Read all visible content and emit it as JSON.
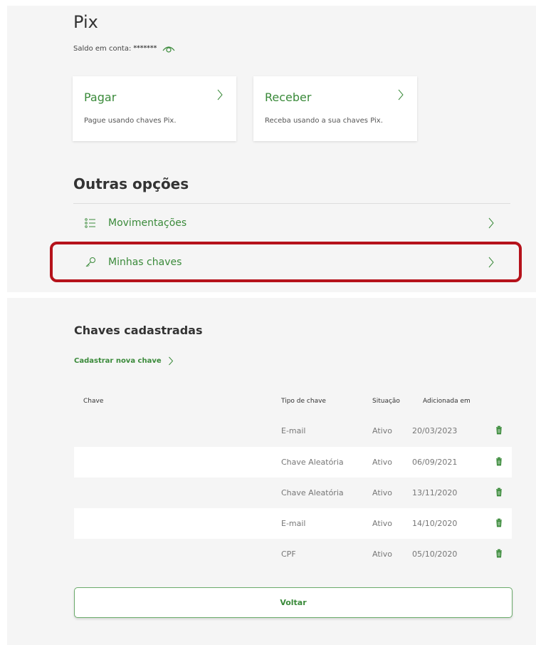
{
  "header": {
    "title": "Pix",
    "balance_label": "Saldo em conta:",
    "balance_value": "*******",
    "eye_icon": "eye-icon"
  },
  "cards": {
    "pay": {
      "title": "Pagar",
      "description": "Pague usando chaves Pix."
    },
    "receive": {
      "title": "Receber",
      "description": "Receba usando a sua chaves Pix."
    }
  },
  "other_options": {
    "title": "Outras opções",
    "items": [
      {
        "label": "Movimentações",
        "icon": "list-icon"
      },
      {
        "label": "Minhas chaves",
        "icon": "key-icon"
      }
    ]
  },
  "keys": {
    "title": "Chaves cadastradas",
    "new_key_label": "Cadastrar nova chave",
    "columns": [
      "Chave",
      "Tipo de chave",
      "Situação",
      "Adicionada em"
    ],
    "rows": [
      {
        "key": "",
        "type": "E-mail",
        "status": "Ativo",
        "date": "20/03/2023"
      },
      {
        "key": "",
        "type": "Chave Aleatória",
        "status": "Ativo",
        "date": "06/09/2021"
      },
      {
        "key": "",
        "type": "Chave Aleatória",
        "status": "Ativo",
        "date": "13/11/2020"
      },
      {
        "key": "",
        "type": "E-mail",
        "status": "Ativo",
        "date": "14/10/2020"
      },
      {
        "key": "",
        "type": "CPF",
        "status": "Ativo",
        "date": "05/10/2020"
      }
    ],
    "back_label": "Voltar"
  },
  "colors": {
    "brand_green": "#3a8a3a",
    "highlight_red": "#b5121b",
    "panel_bg": "#f5f5f5"
  }
}
